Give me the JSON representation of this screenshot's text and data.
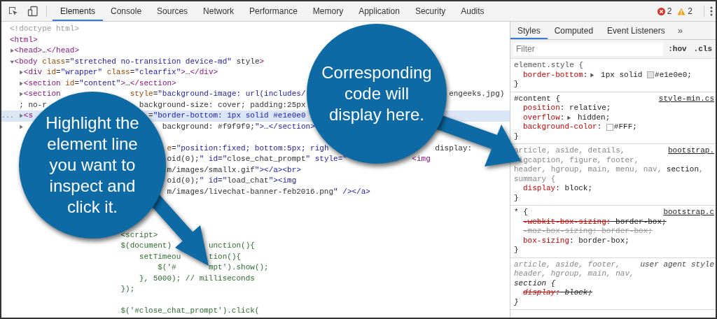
{
  "toolbar": {
    "tabs": [
      {
        "label": "Elements",
        "selected": true
      },
      {
        "label": "Console",
        "selected": false
      },
      {
        "label": "Sources",
        "selected": false
      },
      {
        "label": "Network",
        "selected": false
      },
      {
        "label": "Performance",
        "selected": false
      },
      {
        "label": "Memory",
        "selected": false
      },
      {
        "label": "Application",
        "selected": false
      },
      {
        "label": "Security",
        "selected": false
      },
      {
        "label": "Audits",
        "selected": false
      }
    ],
    "errors": "2",
    "warnings": "2"
  },
  "elements_panel": {
    "lines": [
      {
        "kind": "doctype",
        "selected": false,
        "parts": [
          "<!doctype html>"
        ]
      },
      {
        "kind": "markup",
        "selected": false,
        "parts": [
          "<html>"
        ]
      },
      {
        "kind": "markup",
        "selected": false,
        "expanded": false,
        "parts": [
          "<head>…</head>"
        ]
      },
      {
        "kind": "markup",
        "selected": false,
        "expanded": true,
        "parts": [
          "<body class=\"stretched no-transition device-md\" style>"
        ],
        "children": [
          {
            "kind": "markup",
            "selected": false,
            "expanded": false,
            "parts": [
              "<div id=\"wrapper\" class=\"clearfix\">…</div>"
            ]
          },
          {
            "kind": "markup",
            "selected": false,
            "expanded": false,
            "parts": [
              "<section id=\"content\">…</section>"
            ]
          },
          {
            "kind": "markup",
            "selected": false,
            "expanded": false,
            "parts": [
              "<section",
              "               style=\"background-image: url(includes/",
              "                               engeeks.jpg)"
            ]
          },
          {
            "kind": "markup",
            "selected": false,
            "parts": [
              "; no-r",
              "                    background-size: cover; padding:25px"
            ]
          },
          {
            "kind": "markup",
            "selected": true,
            "gutter": "...",
            "expanded": false,
            "parts": [
              "<s",
              "                         =\"border-bottom: 1px solid #e1e0e0"
            ]
          },
          {
            "kind": "markup",
            "selected": false,
            "expanded": false,
            "parts": [
              "                              background: #f9f9f9;\">…</section>"
            ]
          },
          {
            "kind": "blank"
          },
          {
            "kind": "markup",
            "selected": false,
            "parts": [
              "                                e=\"position:fixed; bottom:5px; righ",
              "                       display:"
            ]
          },
          {
            "kind": "markup",
            "selected": false,
            "parts": [
              "                                oid(0);\" id=\"close_chat_prompt\" style=\"",
              "              <img"
            ]
          },
          {
            "kind": "markup",
            "selected": false,
            "parts": [
              "                                m/images/smallx.gif\"></a><br>"
            ]
          },
          {
            "kind": "markup",
            "selected": false,
            "parts": [
              "                                oid(0);\" id=\"load_chat\"><img"
            ]
          },
          {
            "kind": "markup",
            "selected": false,
            "parts": [
              "                                m/images/livechat-banner-feb2016.png\" /></a>"
            ]
          },
          {
            "kind": "blank"
          },
          {
            "kind": "blank"
          },
          {
            "kind": "blank"
          },
          {
            "kind": "script",
            "selected": false,
            "parts": [
              "                      <script>"
            ]
          },
          {
            "kind": "script",
            "selected": false,
            "parts": [
              "                      $(document)",
              "        unction(){"
            ]
          },
          {
            "kind": "script",
            "selected": false,
            "parts": [
              "                          setTimeou",
              "      tion(){"
            ]
          },
          {
            "kind": "script",
            "selected": false,
            "parts": [
              "                              $('#",
              "       mpt').show();"
            ]
          },
          {
            "kind": "script",
            "selected": false,
            "parts": [
              "                          }, 5000); // milliseconds"
            ]
          },
          {
            "kind": "script",
            "selected": false,
            "parts": [
              "                      });"
            ]
          },
          {
            "kind": "blank"
          },
          {
            "kind": "script",
            "selected": false,
            "parts": [
              "                      $('#close_chat_prompt').click("
            ]
          }
        ]
      }
    ]
  },
  "styles_panel": {
    "tabs": [
      {
        "label": "Styles",
        "selected": true
      },
      {
        "label": "Computed",
        "selected": false
      },
      {
        "label": "Event Listeners",
        "selected": false
      }
    ],
    "more": "»",
    "filter": {
      "placeholder": "Filter"
    },
    "toggles": [
      ":hov",
      ".cls"
    ],
    "rules": [
      {
        "kind": "inline",
        "selector": [
          [
            {
              "text": "element.style {",
              "matched": true
            }
          ]
        ],
        "declarations": [
          {
            "text": "border-bottom: 1px solid #e1e0e0;",
            "expandable": true,
            "color": "#e1e0e0",
            "overridden": false,
            "invalid": false
          }
        ],
        "closing": "}"
      },
      {
        "kind": "author",
        "source": "style-min.cs",
        "selector": [
          [
            {
              "text": "#content {",
              "matched": true
            }
          ]
        ],
        "declarations": [
          {
            "text": "position: relative;",
            "expandable": false,
            "overridden": false,
            "invalid": false
          },
          {
            "text": "overflow: hidden;",
            "expandable": true,
            "overridden": false,
            "invalid": false
          },
          {
            "text": "background-color: #FFF;",
            "expandable": false,
            "color": "#ffffff",
            "overridden": false,
            "invalid": false
          }
        ],
        "closing": "}"
      },
      {
        "kind": "author",
        "source": "bootstrap.",
        "selector": [
          [
            {
              "text": "article, aside, details,",
              "matched": false
            }
          ],
          [
            {
              "text": " igcaption, figure, footer,",
              "matched": false
            }
          ],
          [
            {
              "text": "header, hgroup, main, menu, nav, ",
              "matched": false
            },
            {
              "text": "section",
              "matched": true
            },
            {
              "text": ",",
              "matched": false
            }
          ],
          [
            {
              "text": "summary {",
              "matched": false
            }
          ]
        ],
        "declarations": [
          {
            "text": "display: block;",
            "expandable": false,
            "overridden": false,
            "invalid": false
          }
        ],
        "closing": "}"
      },
      {
        "kind": "author",
        "source": "bootstrap.c",
        "selector": [
          [
            {
              "text": "* {",
              "matched": true
            }
          ]
        ],
        "declarations": [
          {
            "text": "-webkit-box-sizing: border-box;",
            "expandable": false,
            "overridden": true,
            "invalid": false
          },
          {
            "text": "-moz-box-sizing: border-box;",
            "expandable": false,
            "overridden": true,
            "invalid": true
          },
          {
            "text": "box-sizing: border-box;",
            "expandable": false,
            "overridden": false,
            "invalid": false
          }
        ],
        "closing": "}"
      },
      {
        "kind": "user-agent",
        "source": "user agent style",
        "selector": [
          [
            {
              "text": "article, aside, footer,",
              "matched": false
            }
          ],
          [
            {
              "text": "header, hgroup, main, nav,",
              "matched": false
            }
          ],
          [
            {
              "text": "section {",
              "matched": true
            }
          ]
        ],
        "declarations": [
          {
            "text": "display: block;",
            "expandable": false,
            "overridden": true,
            "invalid": false
          }
        ],
        "closing": "}"
      }
    ]
  },
  "callouts": [
    {
      "lines": [
        "Highlight the",
        "element line",
        "you want to",
        "inspect and",
        "click it."
      ]
    },
    {
      "lines": [
        "Corresponding",
        "code will",
        "display here."
      ]
    }
  ]
}
